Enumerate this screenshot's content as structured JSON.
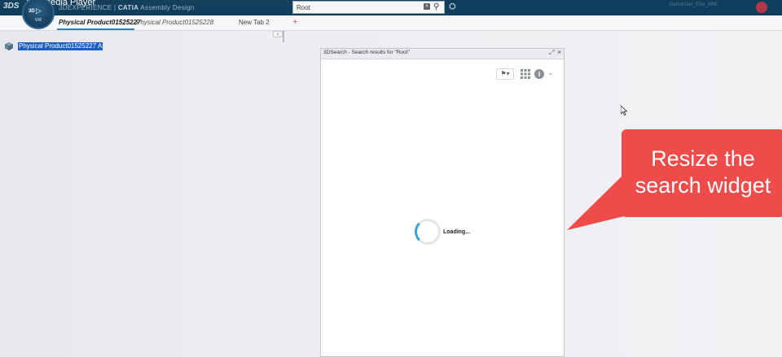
{
  "topbar": {
    "media_title": "Media Player",
    "brand_prefix": "3DEXPERIENCE | ",
    "brand_app": "CATIA",
    "brand_module": "Assembly Design",
    "compass_label": "3D",
    "compass_version": "V.R",
    "search_value": "Root",
    "user_text": "DemoUser_ESe_ARE"
  },
  "tabs": [
    {
      "label": "Physical Product01525227"
    },
    {
      "label": "Physical Product01525228"
    },
    {
      "label": "New Tab 2"
    }
  ],
  "tree": {
    "root_label": "Physical Product01525227 A"
  },
  "widget": {
    "title": "3DSearch - Search results for \"Root\"",
    "loading_text": "Loading..."
  },
  "callout": {
    "line1": "Resize the",
    "line2": "search widget"
  },
  "colors": {
    "topbar": "#0f3d5c",
    "accent": "#2f7fbf",
    "selection": "#1b5fc2",
    "callout": "#ef4b4b",
    "spinner": "#3aa0d8"
  }
}
